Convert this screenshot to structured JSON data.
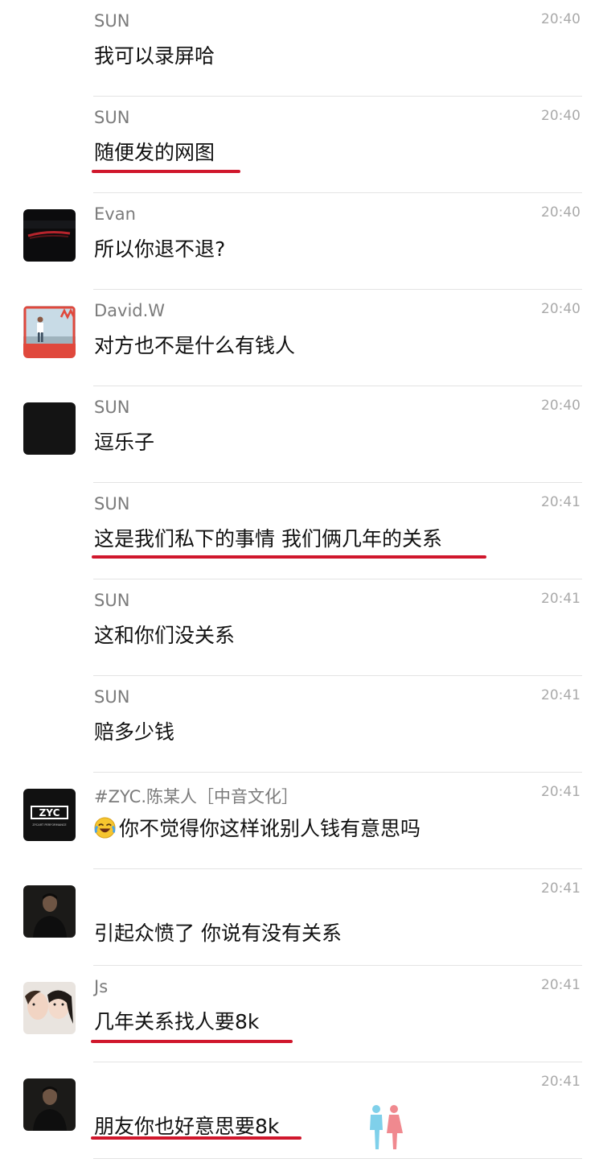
{
  "messages": [
    {
      "sender": "SUN",
      "time": "20:40",
      "text": "我可以录屏哈"
    },
    {
      "sender": "SUN",
      "time": "20:40",
      "text": "随便发的网图"
    },
    {
      "sender": "Evan",
      "time": "20:40",
      "text": "所以你退不退?"
    },
    {
      "sender": "David.W",
      "time": "20:40",
      "text": "对方也不是什么有钱人"
    },
    {
      "sender": "SUN",
      "time": "20:40",
      "text": "逗乐子"
    },
    {
      "sender": "SUN",
      "time": "20:41",
      "text": "这是我们私下的事情 我们俩几年的关系"
    },
    {
      "sender": "SUN",
      "time": "20:41",
      "text": "这和你们没关系"
    },
    {
      "sender": "SUN",
      "time": "20:41",
      "text": "赔多少钱"
    },
    {
      "sender": "#ZYC.陈某人［中音文化］",
      "time": "20:41",
      "text": "你不觉得你这样讹别人钱有意思吗",
      "emoji": "laughing-crying-emoji"
    },
    {
      "sender": "",
      "time": "20:41",
      "text": "引起众愤了 你说有没有关系"
    },
    {
      "sender": "Js",
      "time": "20:41",
      "text": "几年关系找人要8k"
    },
    {
      "sender": "",
      "time": "20:41",
      "text": "朋友你也好意思要8k"
    }
  ],
  "avatar_logo": "ZYC",
  "avatar_logo_sub": "ZYCART PERFORMANCE",
  "highlight_color": "#d0172c"
}
